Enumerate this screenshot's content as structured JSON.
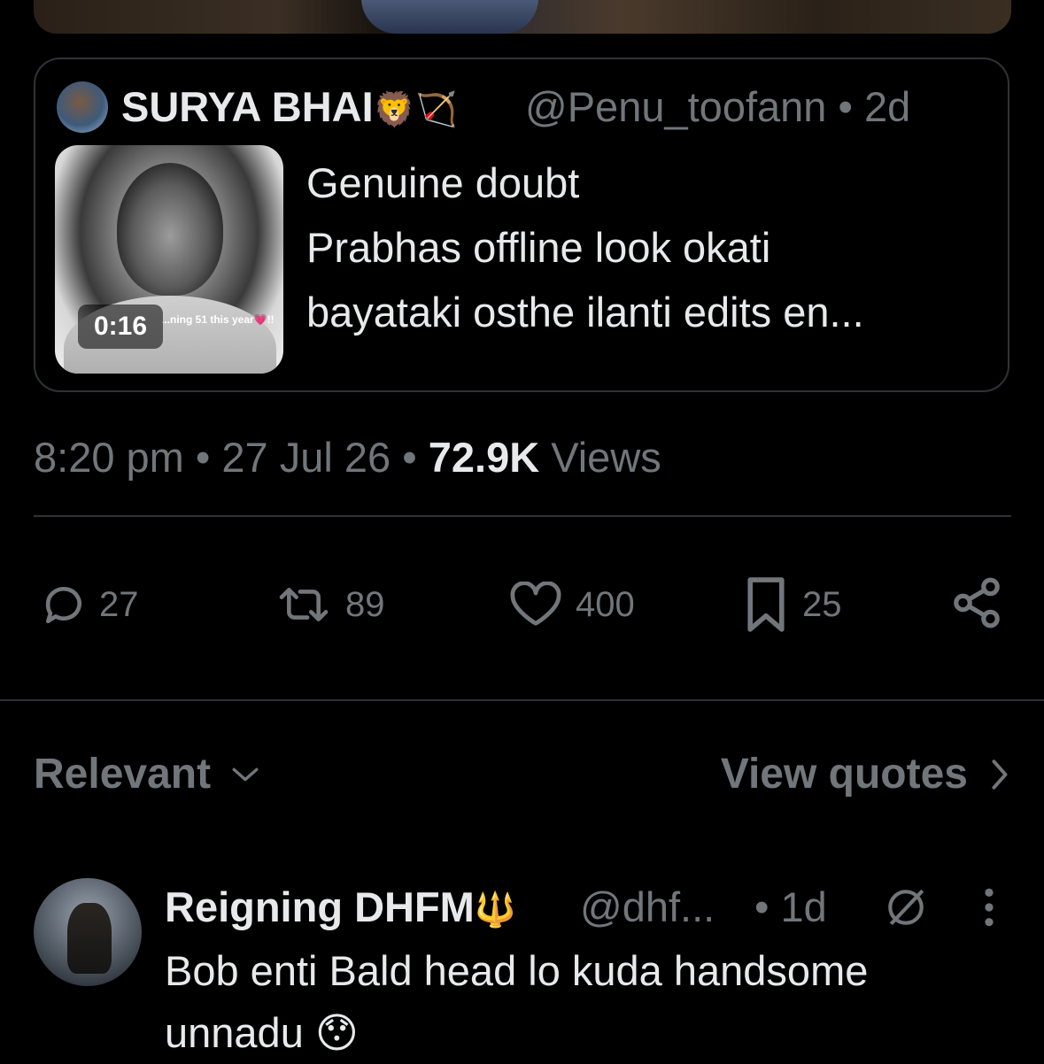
{
  "quoted_tweet": {
    "display_name": "SURYA BHAI",
    "name_emojis": "🦁🏹",
    "handle": "@Penu_toofann",
    "age": "2d",
    "text_lines": [
      "Genuine doubt",
      "Prabhas offline look okati",
      "bayataki osthe ilanti edits en..."
    ],
    "video_duration": "0:16",
    "thumbnail_caption": "...ning 51 this year💗!!"
  },
  "tweet_meta": {
    "time": "8:20 pm",
    "date": "27 Jul 26",
    "views_count": "72.9K",
    "views_label": "Views"
  },
  "actions": {
    "replies": "27",
    "reposts": "89",
    "likes": "400",
    "bookmarks": "25"
  },
  "sort": {
    "label": "Relevant",
    "view_quotes": "View quotes"
  },
  "reply": {
    "display_name": "Reigning DHFM",
    "name_emoji": "🔱",
    "handle": "@dhf...",
    "age": "1d",
    "text": "Bob enti Bald head lo kuda handsome unnadu 😯"
  },
  "colors": {
    "background": "#000000",
    "text_primary": "#e7e9ea",
    "text_secondary": "#71767b",
    "border": "#2f3336"
  }
}
